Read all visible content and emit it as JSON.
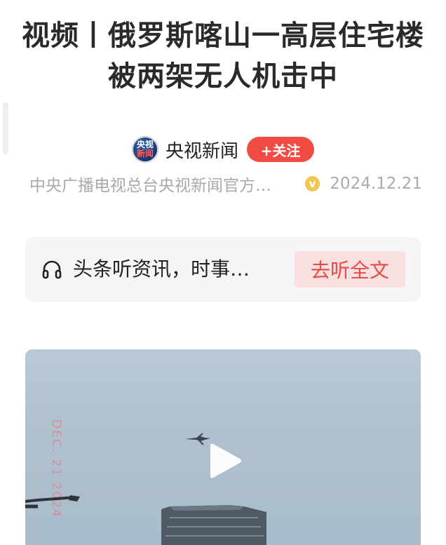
{
  "article": {
    "title": "视频丨俄罗斯喀山一高层住宅楼被两架无人机击中"
  },
  "source": {
    "avatar_text_top": "央视",
    "avatar_text_bottom": "新闻",
    "name": "央视新闻",
    "follow_label": "+关注",
    "description": "中央广播电视总台央视新闻官方…",
    "verified_icon": "v",
    "date": "2024.12.21"
  },
  "listen": {
    "icon": "headphones-icon",
    "text": "头条听资讯，时事…",
    "button_label": "去听全文"
  },
  "video": {
    "overlay_date": "DEC. 21 2024",
    "play_icon": "play-icon"
  },
  "colors": {
    "follow_red": "#f14b44",
    "listen_button_bg": "#f8dfe0",
    "listen_button_text": "#e64b47",
    "verified_yellow": "#f1c54f"
  }
}
